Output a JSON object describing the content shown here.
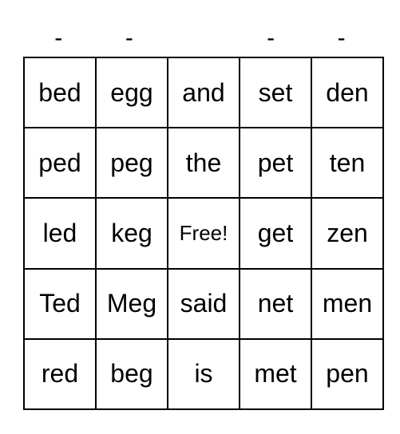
{
  "header": [
    "-",
    "-",
    "",
    "-",
    "-"
  ],
  "card": {
    "rows": [
      [
        "bed",
        "egg",
        "and",
        "set",
        "den"
      ],
      [
        "ped",
        "peg",
        "the",
        "pet",
        "ten"
      ],
      [
        "led",
        "keg",
        "Free!",
        "get",
        "zen"
      ],
      [
        "Ted",
        "Meg",
        "said",
        "net",
        "men"
      ],
      [
        "red",
        "beg",
        "is",
        "met",
        "pen"
      ]
    ],
    "free_cell": [
      2,
      2
    ]
  }
}
